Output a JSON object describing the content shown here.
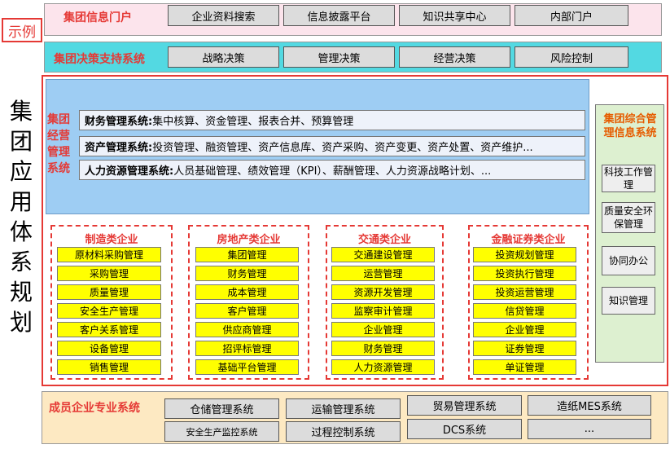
{
  "example_label": "示例",
  "vertical_title": "集团应用体系规划",
  "portal": {
    "title": "集团信息门户",
    "items": [
      "企业资料搜索",
      "信息披露平台",
      "知识共享中心",
      "内部门户"
    ]
  },
  "decision": {
    "title": "集团决策支持系统",
    "items": [
      "战略决策",
      "管理决策",
      "经营决策",
      "风险控制"
    ]
  },
  "operations": {
    "label": "集团经营管理系统",
    "rows": [
      {
        "name": "财务管理系统:",
        "detail": "集中核算、资金管理、报表合并、预算管理"
      },
      {
        "name": "资产管理系统:",
        "detail": "投资管理、融资管理、资产信息库、资产采购、资产变更、资产处置、资产维护..."
      },
      {
        "name": "人力资源管理系统:",
        "detail": "人员基础管理、绩效管理（KPI）、薪酬管理、人力资源战略计划、..."
      }
    ]
  },
  "integrated": {
    "title": "集团综合管理信息系统",
    "items": [
      "科技工作管理",
      "质量安全环保管理",
      "协同办公",
      "知识管理"
    ]
  },
  "industries": [
    {
      "title": "制造类企业",
      "items": [
        "原材料采购管理",
        "采购管理",
        "质量管理",
        "安全生产管理",
        "客户关系管理",
        "设备管理",
        "销售管理"
      ]
    },
    {
      "title": "房地产类企业",
      "items": [
        "集团管理",
        "财务管理",
        "成本管理",
        "客户管理",
        "供应商管理",
        "招评标管理",
        "基础平台管理"
      ]
    },
    {
      "title": "交通类企业",
      "items": [
        "交通建设管理",
        "运营管理",
        "资源开发管理",
        "监察审计管理",
        "企业管理",
        "财务管理",
        "人力资源管理"
      ]
    },
    {
      "title": "金融证券类企业",
      "items": [
        "投资规划管理",
        "投资执行管理",
        "投资运营管理",
        "信贷管理",
        "企业管理",
        "证券管理",
        "单证管理"
      ]
    }
  ],
  "member": {
    "title": "成员企业专业系统",
    "row1": [
      "仓储管理系统",
      "运输管理系统",
      "贸易管理系统",
      "造纸MES系统"
    ],
    "row2": [
      "安全生产监控系统",
      "过程控制系统",
      "DCS系统",
      "..."
    ]
  },
  "colors": {
    "red": "#e53935",
    "cyan": "#53d9e2",
    "blue": "#9ecdf3",
    "yellow": "#ffff00",
    "green": "#ddf0d0",
    "orange": "#fde9c2",
    "pink": "#fce4ec"
  }
}
